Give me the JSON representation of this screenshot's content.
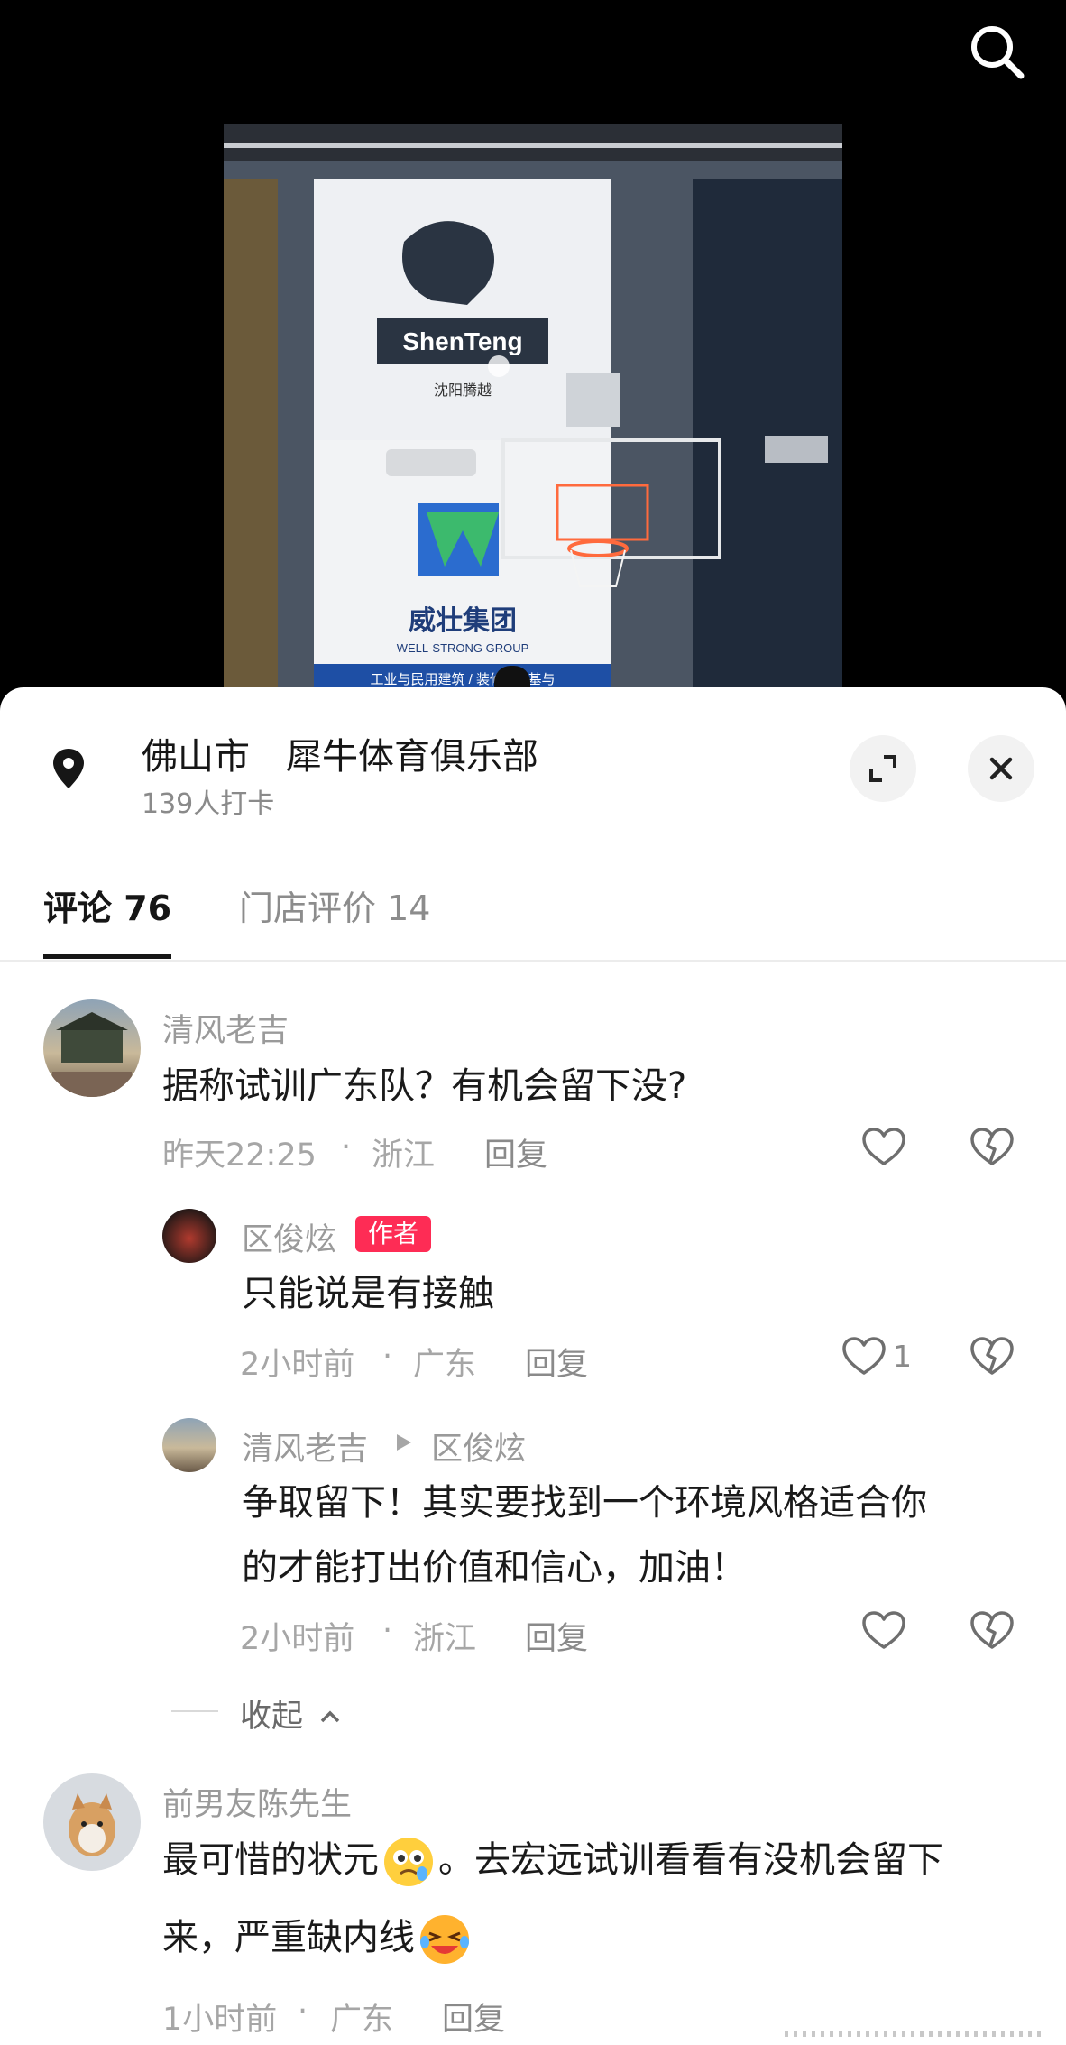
{
  "header": {
    "search_icon": "search-icon"
  },
  "video": {
    "logo_text": "ShenTeng",
    "logo_sub": "沈阳腾越",
    "sponsor_text": "威壮集团",
    "sponsor_sub": "WELL-STRONG GROUP",
    "banner_text": "工业与民用建筑 / 装修 / 地基与"
  },
  "location": {
    "city": "佛山市",
    "name": "犀牛体育俱乐部",
    "checkins": "139人打卡"
  },
  "tabs": [
    {
      "label": "评论 76",
      "active": true
    },
    {
      "label": "门店评价 14",
      "active": false
    }
  ],
  "comments": [
    {
      "user": "清风老吉",
      "text": "据称试训广东队？有机会留下没?",
      "time": "昨天22:25",
      "region": "浙江",
      "reply_label": "回复",
      "likes": ""
    },
    {
      "user": "区俊炫",
      "badge": "作者",
      "text": "只能说是有接触",
      "time": "2小时前",
      "region": "广东",
      "reply_label": "回复",
      "likes": "1"
    },
    {
      "user": "清风老吉",
      "reply_to": "区俊炫",
      "text_line1": "争取留下！其实要找到一个环境风格适合你",
      "text_line2": "的才能打出价值和信心，加油！",
      "time": "2小时前",
      "region": "浙江",
      "reply_label": "回复"
    },
    {
      "user": "前男友陈先生",
      "text_line1_a": "最可惜的状元",
      "text_line1_b": "。去宏远试训看看有没机会留下",
      "text_line2_a": "来，严重缺内线",
      "time": "1小时前",
      "region": "广东",
      "reply_label": "回复"
    }
  ],
  "collapse_label": "收起",
  "separator": "·"
}
